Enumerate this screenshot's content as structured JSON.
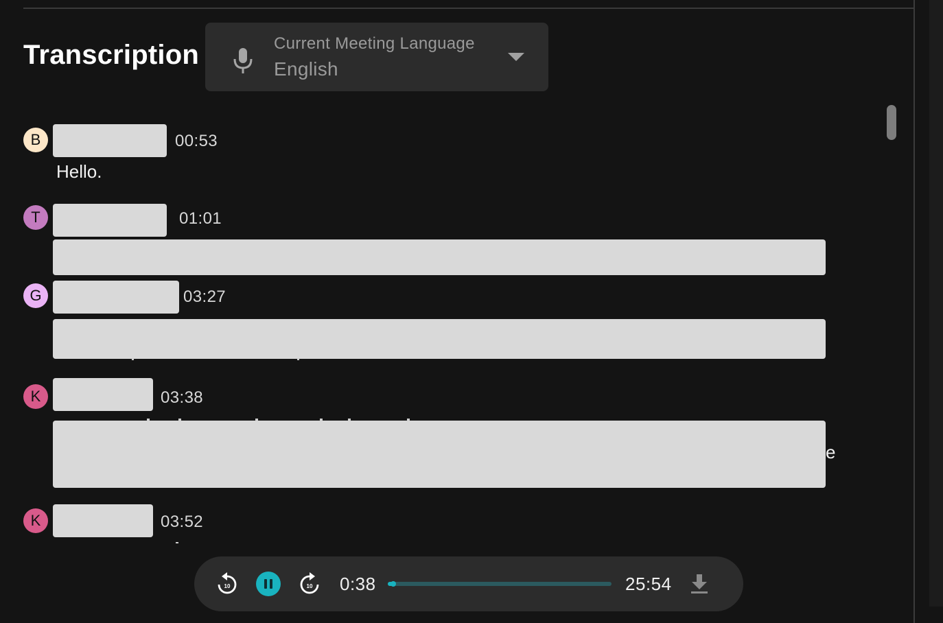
{
  "header": {
    "title": "Transcription"
  },
  "language_select": {
    "label": "Current Meeting Language",
    "value": "English",
    "icon": "mic-icon"
  },
  "transcript": [
    {
      "initial": "B",
      "avatar_color": "#fde7c8",
      "time": "00:53",
      "text": "Hello."
    },
    {
      "initial": "T",
      "avatar_color": "#c37bbf",
      "time": "01:01",
      "text": ""
    },
    {
      "initial": "G",
      "avatar_color": "#eab3f5",
      "time": "03:27",
      "text": ""
    },
    {
      "initial": "K",
      "avatar_color": "#d85a8a",
      "time": "03:38",
      "text": "",
      "trailing_char": "e"
    },
    {
      "initial": "K",
      "avatar_color": "#d85a8a",
      "time": "03:52",
      "text": ""
    }
  ],
  "player": {
    "current_time": "0:38",
    "total_time": "25:54",
    "progress": 0.024,
    "accent_color": "#19b3bf",
    "rewind_seconds": "10",
    "forward_seconds": "10"
  }
}
